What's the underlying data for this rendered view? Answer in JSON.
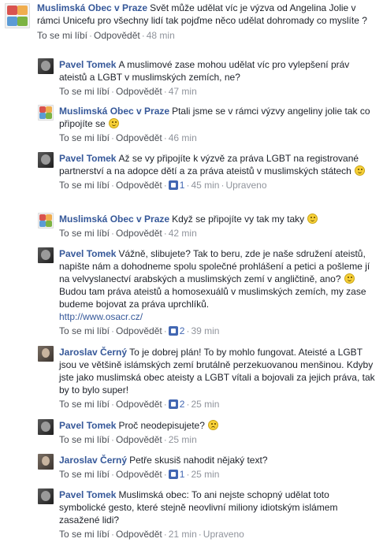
{
  "actions": {
    "like": "To se mi líbí",
    "reply": "Odpovědět",
    "edited": "Upraveno"
  },
  "comments": [
    {
      "author": "Muslimská Obec v Praze",
      "text": "Svět může udělat víc je výzva od Angelina Jolie v rámci Unicefu pro všechny lidí tak pojďme něco udělat dohromady co myslíte ?",
      "time": "48 min"
    },
    {
      "author": "Pavel Tomek",
      "text": "A muslimové zase mohou udělat víc pro vylepšení práv ateistů a LGBT v muslimských zemích, ne?",
      "time": "47 min"
    },
    {
      "author": "Muslimská Obec v Praze",
      "text": "Ptali jsme se v rámci výzvy angeliny jolie tak co připojíte se",
      "time": "46 min"
    },
    {
      "author": "Pavel Tomek",
      "text": "Až se vy připojíte k výzvě za práva LGBT na registrované partnerství a na adopce dětí a za práva ateistů v muslimských státech",
      "likes": "1",
      "time": "45 min"
    },
    {
      "author": "Muslimská Obec v Praze",
      "text": "Když se připojíte vy tak my taky",
      "time": "42 min"
    },
    {
      "author": "Pavel Tomek",
      "text": "Vážně, slibujete? Tak to beru, zde je naše sdružení ateistů, napište nám a dohodneme spolu společné prohlášení a petici a pošleme jí na velvyslanectví arabských a muslimských zemí v angličtině, ano?",
      "text2": "Budou tam práva ateistů a homosexuálů v muslimských zemích, my zase budeme bojovat za práva uprchlíků.",
      "link": "http://www.osacr.cz/",
      "likes": "2",
      "time": "39 min"
    },
    {
      "author": "Jaroslav Černý",
      "text": "To je dobrej plán! To by mohlo fungovat. Ateisté a LGBT jsou ve většině islámských zemí brutálně perzekuovanou menšinou. Kdyby jste jako muslimská obec ateisty a LGBT vítali a bojovali za jejich práva, tak by to bylo super!",
      "likes": "2",
      "time": "25 min"
    },
    {
      "author": "Pavel Tomek",
      "text": "Proč neodepisujete?",
      "time": "25 min"
    },
    {
      "author": "Jaroslav Černý",
      "text": "Petře skusiš nahodit nějaký text?",
      "likes": "1",
      "time": "25 min"
    },
    {
      "author": "Pavel Tomek",
      "text": "Muslimská obec: To ani nejste schopný udělat toto symbolické gesto, které stejně neovlivní miliony idiotským islámem zasažené lidi?",
      "time": "21 min"
    }
  ]
}
